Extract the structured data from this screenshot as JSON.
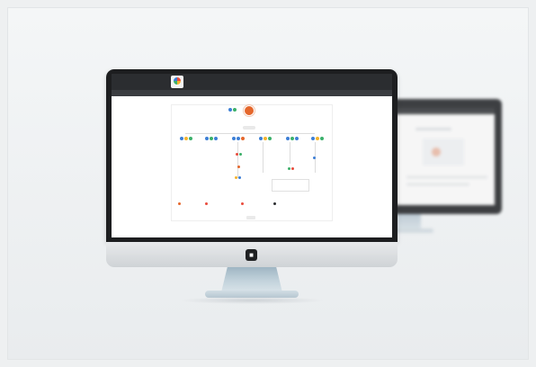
{
  "colors": {
    "page_background": "#eef0f1",
    "bezel": "#1d1e20",
    "topbar": "#2b2d30",
    "accent_orange": "#e5672c",
    "node_blue": "#3d7fd6",
    "node_green": "#3bb06a",
    "node_yellow": "#f5b32c",
    "node_red": "#e94c3d",
    "stand": "#b7c7d1"
  },
  "icons": {
    "monitor_logo": "apple-style-logo-icon",
    "app_logo": "multicolor-circle-logo-icon"
  },
  "screen": {
    "brand": "",
    "topbar_info": "",
    "user_info": "",
    "nav_items": [
      "",
      "",
      "",
      "",
      "",
      ""
    ],
    "left_label": "",
    "right_label": "",
    "root_title": "",
    "root_subtitle": "",
    "legend": [
      "",
      "",
      "",
      ""
    ],
    "page_button": "",
    "footer": [
      "",
      "",
      ""
    ]
  }
}
